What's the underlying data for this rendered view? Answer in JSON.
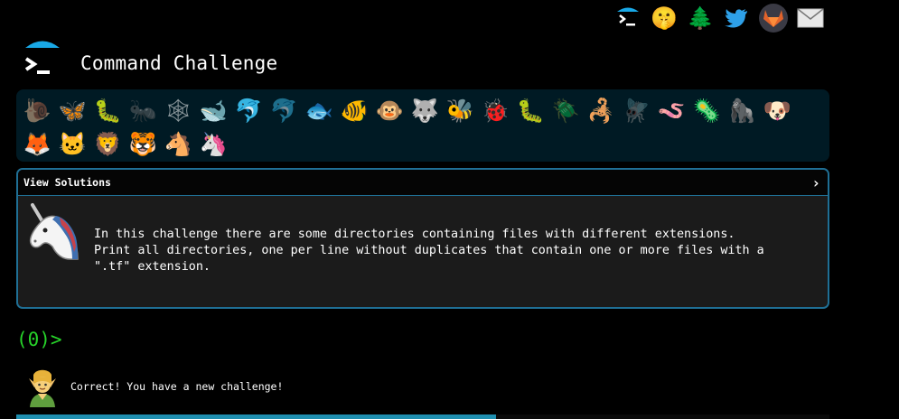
{
  "header": {
    "title": "Command Challenge",
    "icons": [
      "terminal-icon",
      "shushing-face-icon",
      "tree-icon",
      "twitter-bird-icon",
      "gitlab-fox-icon",
      "envelope-icon"
    ]
  },
  "animals": [
    "snail",
    "butterfly",
    "bug",
    "ant",
    "spider-web",
    "whale",
    "dolphin",
    "porpoise",
    "fish",
    "tropical-fish",
    "monkey-face",
    "wolf",
    "bee",
    "ladybug",
    "caterpillar",
    "beetle",
    "scorpion",
    "fly",
    "worm",
    "microbe",
    "gorilla",
    "dog",
    "fox",
    "cat",
    "lion",
    "tiger",
    "horse",
    "unicorn"
  ],
  "panel": {
    "header_label": "View Solutions",
    "description_lines": [
      "In this challenge there are some directories containing files with different extensions.",
      "Print all directories, one per line without duplicates that contain one or more files with a",
      "\".tf\" extension."
    ]
  },
  "prompt": "(0)>",
  "message": "Correct! You have a new challenge!",
  "progress": 0.59,
  "colors": {
    "prompt_green": "#27d42a",
    "panel_border": "#1f6f95",
    "strip_bg": "#001a24",
    "progress_fill": "#1f8fb0"
  }
}
